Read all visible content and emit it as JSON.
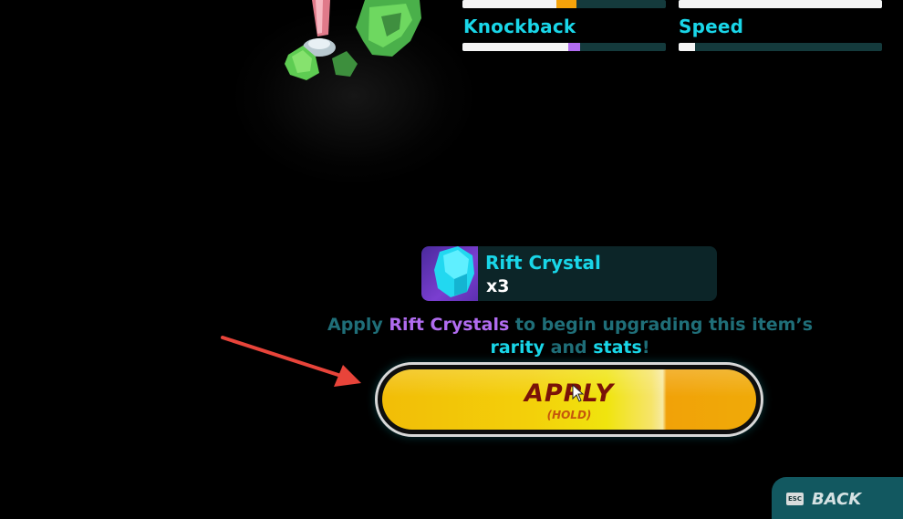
{
  "stats": {
    "top_bars": [
      {
        "name": "hidden-stat-left",
        "level": 0.46,
        "boost": 0.1,
        "boost_color": "#f5a30a"
      },
      {
        "name": "hidden-stat-right",
        "level": 1.0,
        "boost": 0.0,
        "boost_color": "#b16cf0"
      }
    ],
    "knockback": {
      "label": "Knockback",
      "level": 0.52,
      "boost": 0.06,
      "boost_color": "#b16cf0"
    },
    "speed": {
      "label": "Speed",
      "level": 0.08,
      "boost": 0.0,
      "boost_color": "#b16cf0"
    }
  },
  "crystal": {
    "name": "Rift Crystal",
    "count": "x3",
    "icon": "rift-crystal-icon"
  },
  "instructions": {
    "part1": "Apply ",
    "highlight1": "Rift Crystals",
    "part2": " to begin upgrading this item’s ",
    "highlight2": "rarity",
    "part3": " and ",
    "highlight3": "stats",
    "part4": "!"
  },
  "apply_button": {
    "label": "APPLY",
    "sublabel": "(HOLD)",
    "hold_progress": 0.75
  },
  "back_button": {
    "key": "ESC",
    "label": "BACK"
  },
  "colors": {
    "accent_cyan": "#19d6e8",
    "accent_purple": "#b16cf0",
    "apply_yellow": "#f3d00a",
    "arrow_red": "#e8443a"
  }
}
